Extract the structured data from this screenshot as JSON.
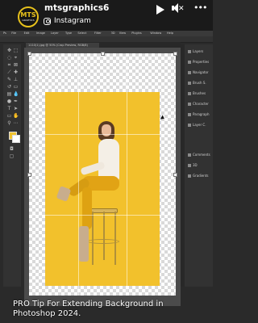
{
  "story": {
    "account_logo_text": "MTS",
    "account_logo_subtext": "GRAPHICS",
    "username": "mtsgraphics6",
    "source": "Instagram",
    "controls": [
      "play-icon",
      "mute-icon",
      "more-icon"
    ]
  },
  "photoshop": {
    "menu_items": [
      "Ps",
      "File",
      "Edit",
      "Image",
      "Layer",
      "Type",
      "Select",
      "Filter",
      "3D",
      "View",
      "Plugins",
      "Window",
      "Help"
    ],
    "document_tab": "1110(1).jpg @ 50% (Crop Preview, RGB/8)",
    "right_panel_items": [
      "Layers",
      "Properties",
      "Navigator",
      "Brush S.",
      "Brushes",
      "Character",
      "Paragraph",
      "Layer C.",
      "Comments",
      "3D",
      "Gradients"
    ],
    "swatch_colors": {
      "foreground": "#f0c22f",
      "background": "#ffffff"
    }
  },
  "caption": "PRO Tip For Extending Background in Photoshop 2024."
}
